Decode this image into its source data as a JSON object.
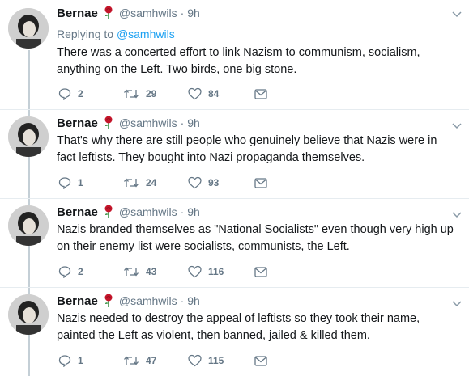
{
  "colors": {
    "link": "#1da1f2",
    "meta": "#657786",
    "text": "#14171a",
    "thread_line": "#c4cfd6",
    "rose": "#c4152a"
  },
  "author": {
    "name": "Bernae",
    "emoji": "rose",
    "handle": "@samhwils",
    "time": "· 9h"
  },
  "replying": {
    "prefix": "Replying to",
    "handle": "@samhwils"
  },
  "tweets": [
    {
      "text": "There was a concerted effort to link Nazism to communism, socialism, anything on the Left. Two birds, one big stone.",
      "replies": "2",
      "retweets": "29",
      "likes": "84"
    },
    {
      "text": "That's why there are still people who genuinely believe that Nazis were in fact leftists. They bought into Nazi propaganda themselves.",
      "replies": "1",
      "retweets": "24",
      "likes": "93"
    },
    {
      "text": "Nazis branded themselves as \"National Socialists\" even though very high up on their enemy list were socialists, communists, the Left.",
      "replies": "2",
      "retweets": "43",
      "likes": "116"
    },
    {
      "text": "Nazis needed to destroy the appeal of leftists so they took their name, painted the Left as violent, then banned, jailed & killed them.",
      "replies": "1",
      "retweets": "47",
      "likes": "115"
    }
  ],
  "icons": [
    "reply-icon",
    "retweet-icon",
    "like-icon",
    "dm-icon",
    "chevron-down-icon",
    "rose-icon"
  ]
}
